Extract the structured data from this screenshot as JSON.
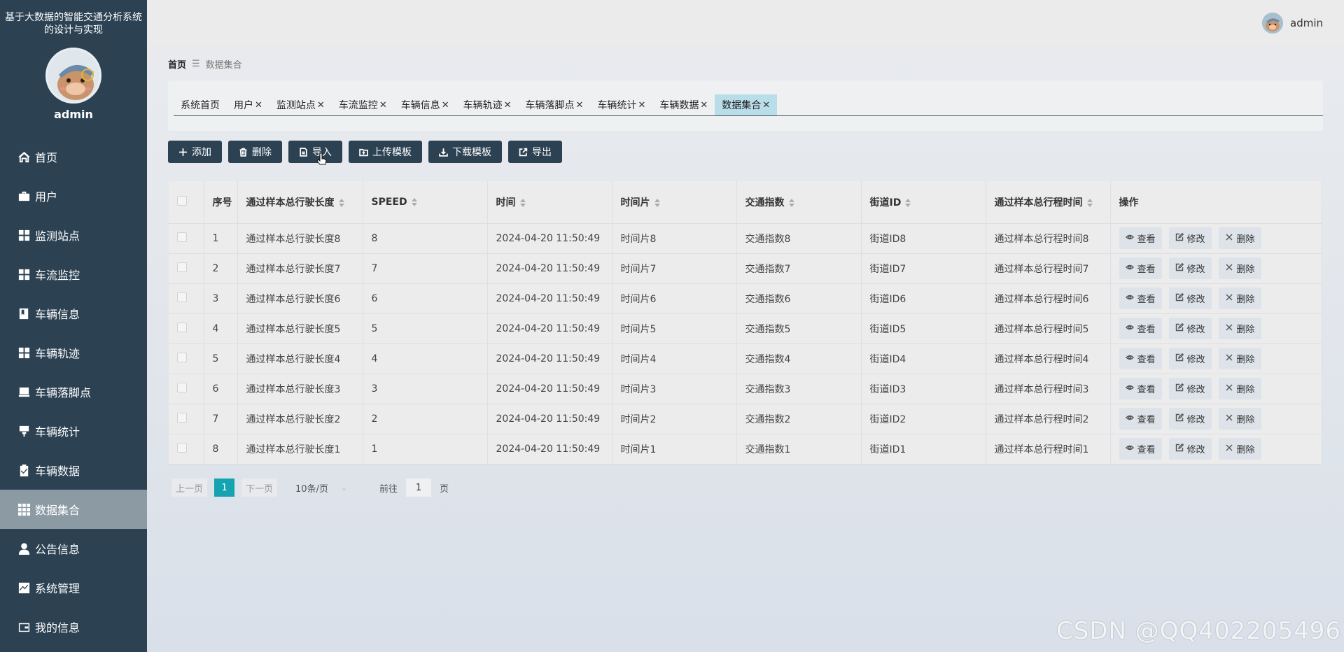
{
  "sidebar": {
    "system_title": "基于大数据的智能交通分析系统的设计与实现",
    "username": "admin",
    "items": [
      {
        "label": "首页",
        "icon": "home-icon"
      },
      {
        "label": "用户",
        "icon": "briefcase-icon"
      },
      {
        "label": "监测站点",
        "icon": "grid-icon"
      },
      {
        "label": "车流监控",
        "icon": "grid-icon"
      },
      {
        "label": "车辆信息",
        "icon": "book-icon"
      },
      {
        "label": "车辆轨迹",
        "icon": "grid-icon"
      },
      {
        "label": "车辆落脚点",
        "icon": "truck-icon"
      },
      {
        "label": "车辆统计",
        "icon": "stamp-icon"
      },
      {
        "label": "车辆数据",
        "icon": "clipboard-check-icon"
      },
      {
        "label": "数据集合",
        "icon": "apps-icon"
      },
      {
        "label": "公告信息",
        "icon": "person-icon"
      },
      {
        "label": "系统管理",
        "icon": "chart-icon"
      },
      {
        "label": "我的信息",
        "icon": "wallet-icon"
      }
    ],
    "active_item": "数据集合"
  },
  "header": {
    "username": "admin"
  },
  "breadcrumb": {
    "home": "首页",
    "separator": "☰",
    "current": "数据集合"
  },
  "tabs": [
    {
      "label": "系统首页",
      "closable": false
    },
    {
      "label": "用户",
      "closable": true
    },
    {
      "label": "监测站点",
      "closable": true
    },
    {
      "label": "车流监控",
      "closable": true
    },
    {
      "label": "车辆信息",
      "closable": true
    },
    {
      "label": "车辆轨迹",
      "closable": true
    },
    {
      "label": "车辆落脚点",
      "closable": true
    },
    {
      "label": "车辆统计",
      "closable": true
    },
    {
      "label": "车辆数据",
      "closable": true
    },
    {
      "label": "数据集合",
      "closable": true,
      "active": true
    }
  ],
  "toolbar": {
    "add": "添加",
    "delete": "删除",
    "import": "导入",
    "upload_template": "上传模板",
    "download_template": "下载模板",
    "export": "导出"
  },
  "table": {
    "headers": {
      "index": "序号",
      "length": "通过样本总行驶长度",
      "speed": "SPEED",
      "time": "时间",
      "time_slice": "时间片",
      "traffic_index": "交通指数",
      "street_id": "街道ID",
      "travel_time": "通过样本总行程时间",
      "actions": "操作"
    },
    "action_labels": {
      "view": "查看",
      "edit": "修改",
      "delete": "删除"
    },
    "rows": [
      {
        "index": "1",
        "length": "通过样本总行驶长度8",
        "speed": "8",
        "time": "2024-04-20 11:50:49",
        "time_slice": "时间片8",
        "traffic_index": "交通指数8",
        "street_id": "街道ID8",
        "travel_time": "通过样本总行程时间8"
      },
      {
        "index": "2",
        "length": "通过样本总行驶长度7",
        "speed": "7",
        "time": "2024-04-20 11:50:49",
        "time_slice": "时间片7",
        "traffic_index": "交通指数7",
        "street_id": "街道ID7",
        "travel_time": "通过样本总行程时间7"
      },
      {
        "index": "3",
        "length": "通过样本总行驶长度6",
        "speed": "6",
        "time": "2024-04-20 11:50:49",
        "time_slice": "时间片6",
        "traffic_index": "交通指数6",
        "street_id": "街道ID6",
        "travel_time": "通过样本总行程时间6"
      },
      {
        "index": "4",
        "length": "通过样本总行驶长度5",
        "speed": "5",
        "time": "2024-04-20 11:50:49",
        "time_slice": "时间片5",
        "traffic_index": "交通指数5",
        "street_id": "街道ID5",
        "travel_time": "通过样本总行程时间5"
      },
      {
        "index": "5",
        "length": "通过样本总行驶长度4",
        "speed": "4",
        "time": "2024-04-20 11:50:49",
        "time_slice": "时间片4",
        "traffic_index": "交通指数4",
        "street_id": "街道ID4",
        "travel_time": "通过样本总行程时间4"
      },
      {
        "index": "6",
        "length": "通过样本总行驶长度3",
        "speed": "3",
        "time": "2024-04-20 11:50:49",
        "time_slice": "时间片3",
        "traffic_index": "交通指数3",
        "street_id": "街道ID3",
        "travel_time": "通过样本总行程时间3"
      },
      {
        "index": "7",
        "length": "通过样本总行驶长度2",
        "speed": "2",
        "time": "2024-04-20 11:50:49",
        "time_slice": "时间片2",
        "traffic_index": "交通指数2",
        "street_id": "街道ID2",
        "travel_time": "通过样本总行程时间2"
      },
      {
        "index": "8",
        "length": "通过样本总行驶长度1",
        "speed": "1",
        "time": "2024-04-20 11:50:49",
        "time_slice": "时间片1",
        "traffic_index": "交通指数1",
        "street_id": "街道ID1",
        "travel_time": "通过样本总行程时间1"
      }
    ]
  },
  "pagination": {
    "prev": "上一页",
    "current_page": "1",
    "next": "下一页",
    "page_size": "10条/页",
    "goto_label": "前往",
    "goto_value": "1",
    "page_unit": "页"
  },
  "watermark": "CSDN @QQ402205496",
  "colors": {
    "sidebar_bg": "#2c4253",
    "active_menu_bg": "#8c9aa4",
    "primary_button": "#2c4253",
    "active_tab": "#b9dde9",
    "pager_active": "#16a3b1"
  }
}
